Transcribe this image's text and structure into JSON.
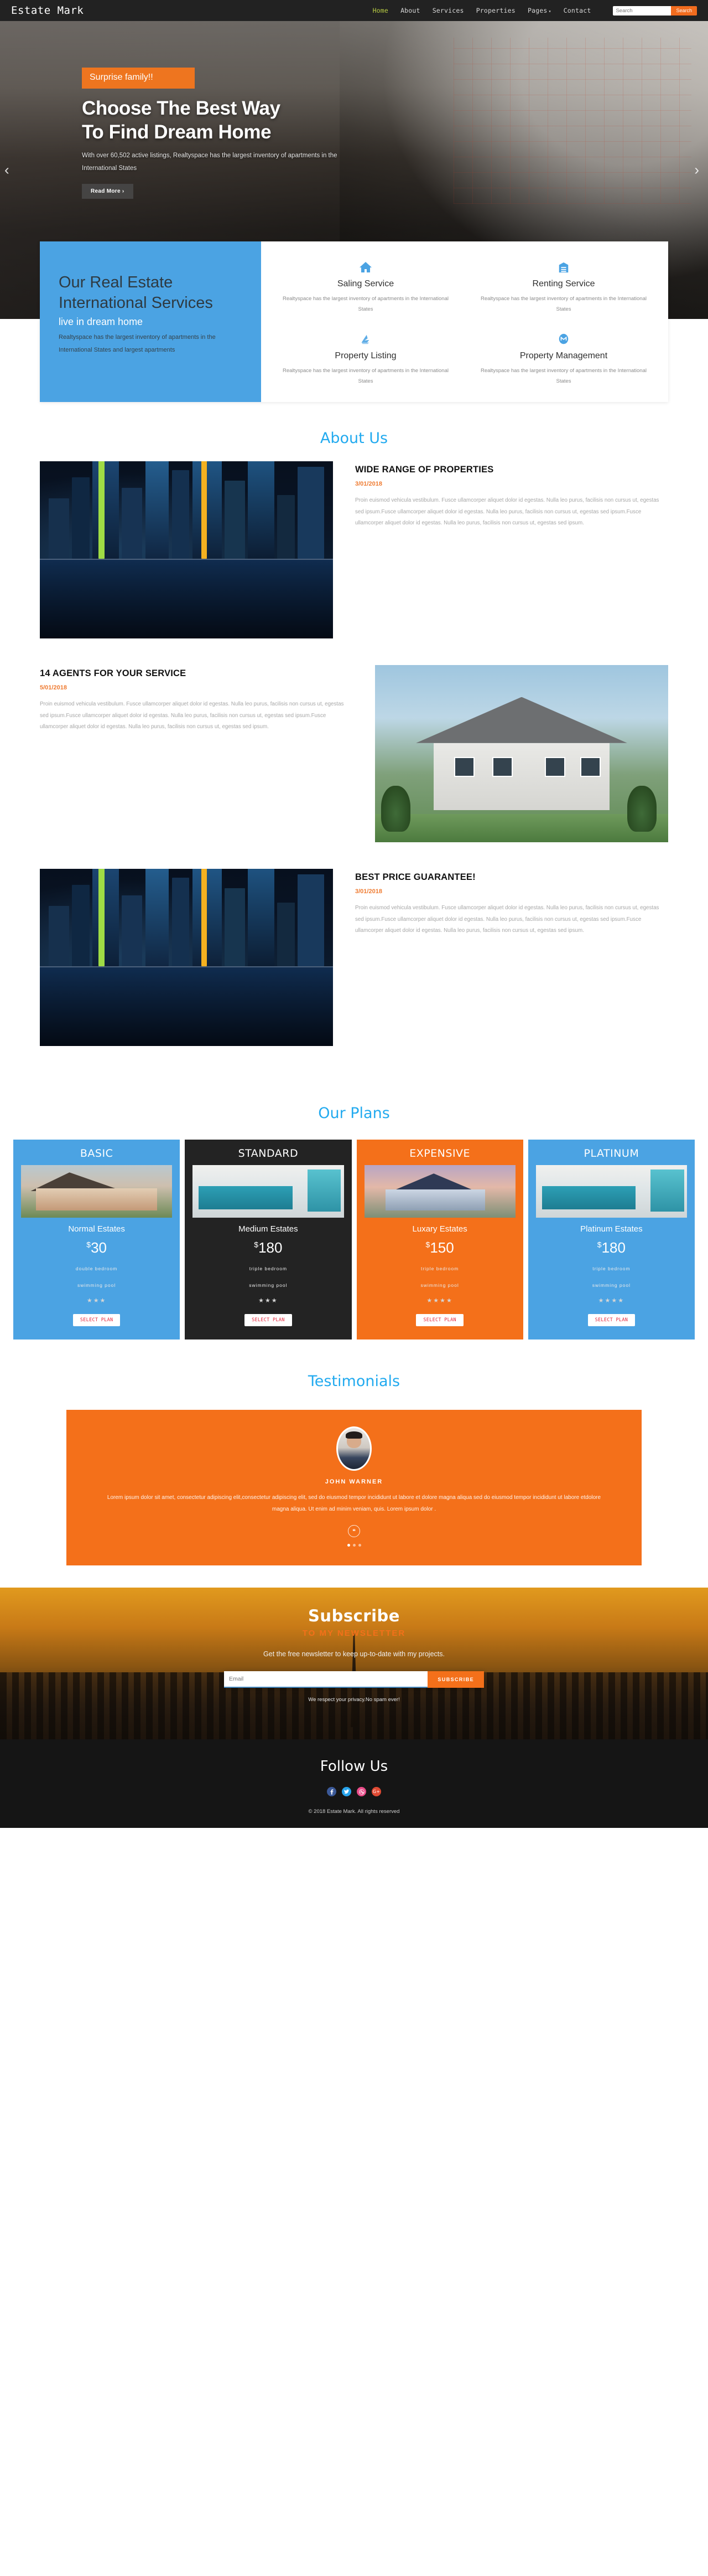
{
  "nav": {
    "brand": "Estate Mark",
    "links": [
      {
        "label": "Home",
        "active": true
      },
      {
        "label": "About",
        "active": false
      },
      {
        "label": "Services",
        "active": false
      },
      {
        "label": "Properties",
        "active": false
      },
      {
        "label": "Pages",
        "active": false,
        "caret": "▾"
      },
      {
        "label": "Contact",
        "active": false
      }
    ],
    "search_placeholder": "Search",
    "search_button": "Search"
  },
  "hero": {
    "badge": "Surprise family!!",
    "title_line1": "Choose The Best Way",
    "title_line2": "To Find Dream Home",
    "subtitle": "With over 60,502 active listings, Realtyspace has the largest inventory of apartments in the International States",
    "cta": "Read More ›",
    "arrow_left": "‹",
    "arrow_right": "›"
  },
  "services_panel": {
    "heading": "Our Real Estate International Services",
    "subheading": "live in dream home",
    "text": "Realtyspace has the largest inventory of apartments in the International States and largest apartments",
    "items": [
      {
        "icon": "home-icon",
        "title": "Saling Service",
        "text": "Realtyspace has the largest inventory of apartments in the International States"
      },
      {
        "icon": "building-icon",
        "title": "Renting Service",
        "text": "Realtyspace has the largest inventory of apartments in the International States"
      },
      {
        "icon": "listing-icon",
        "title": "Property Listing",
        "text": "Realtyspace has the largest inventory of apartments in the International States"
      },
      {
        "icon": "management-icon",
        "title": "Property Management",
        "text": "Realtyspace has the largest inventory of apartments in the International States"
      }
    ]
  },
  "about": {
    "title": "About Us",
    "body": "Proin euismod vehicula vestibulum. Fusce ullamcorper aliquet dolor id egestas. Nulla leo purus, facilisis non cursus ut, egestas sed ipsum.Fusce ullamcorper aliquet dolor id egestas. Nulla leo purus, facilisis non cursus ut, egestas sed ipsum.Fusce ullamcorper aliquet dolor id egestas. Nulla leo purus, facilisis non cursus ut, egestas sed ipsum.",
    "articles": [
      {
        "title": "WIDE RANGE OF PROPERTIES",
        "date": "3/01/2018",
        "image": "city-skyline-night"
      },
      {
        "title": "14 AGENTS FOR YOUR SERVICE",
        "date": "5/01/2018",
        "image": "white-house-exterior"
      },
      {
        "title": "BEST PRICE GUARANTEE!",
        "date": "3/01/2018",
        "image": "city-skyline-night"
      }
    ]
  },
  "plans": {
    "title": "Our Plans",
    "items": [
      {
        "name": "BASIC",
        "subtitle": "Normal Estates",
        "currency": "$",
        "price": "30",
        "feature1": "double bedroom",
        "feature2": "swimming pool",
        "stars": "★★★",
        "button": "SELECT PLAN",
        "theme": "blue",
        "image": "suburban-house"
      },
      {
        "name": "STANDARD",
        "subtitle": "Medium Estates",
        "currency": "$",
        "price": "180",
        "feature1": "triple bedroom",
        "feature2": "swimming pool",
        "stars": "★★★",
        "button": "SELECT PLAN",
        "theme": "dark",
        "image": "modern-kitchen"
      },
      {
        "name": "EXPENSIVE",
        "subtitle": "Luxary Estates",
        "currency": "$",
        "price": "150",
        "feature1": "triple bedroom",
        "feature2": "swimming pool",
        "stars": "★★★★",
        "button": "SELECT PLAN",
        "theme": "orange",
        "image": "blue-house-dusk"
      },
      {
        "name": "PLATINUM",
        "subtitle": "Platinum Estates",
        "currency": "$",
        "price": "180",
        "feature1": "triple bedroom",
        "feature2": "swimming pool",
        "stars": "★★★★",
        "button": "SELECT PLAN",
        "theme": "blue",
        "image": "modern-kitchen"
      }
    ]
  },
  "testimonials": {
    "title": "Testimonials",
    "name": "JOHN WARNER",
    "quote": "Lorem ipsum dolor sit amet, consectetur adipiscing elit,consectetur adipiscing elit, sed do eiusmod tempor incididunt ut labore et dolore magna aliqua sed do eiusmod tempor incididunt ut labore etdolore magna aliqua. Ut enim ad minim veniam, quis. Lorem ipsum dolor .",
    "quote_mark": "❝",
    "dots": 3,
    "active_dot": 0
  },
  "subscribe": {
    "title": "Subscribe",
    "subtitle": "TO MY NEWSLETTER",
    "description": "Get the free newsletter to keep up-to-date with my projects.",
    "email_placeholder": "Email",
    "button": "SUBSCRIBE",
    "note": "We respect your privacy.No spam ever!"
  },
  "footer": {
    "title": "Follow Us",
    "socials": [
      {
        "name": "facebook",
        "glyph": "f"
      },
      {
        "name": "twitter",
        "glyph": "🐦"
      },
      {
        "name": "dribbble",
        "glyph": "◉"
      },
      {
        "name": "google-plus",
        "glyph": "G+"
      }
    ],
    "copyright": "© 2018 Estate Mark. All rights reserved"
  }
}
